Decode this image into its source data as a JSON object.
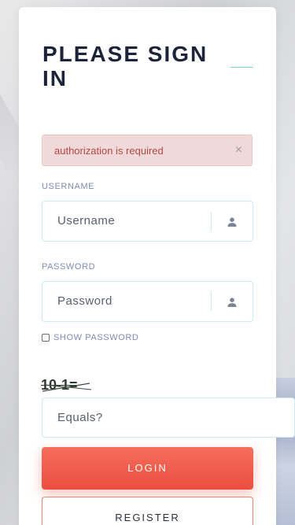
{
  "login": {
    "title": "PLEASE SIGN IN",
    "alert": {
      "message": "authorization is required",
      "close": "×"
    },
    "username": {
      "label": "USERNAME",
      "placeholder": "Username"
    },
    "password": {
      "label": "PASSWORD",
      "placeholder": "Password"
    },
    "show_password_label": "SHOW PASSWORD",
    "show_password_checked": false,
    "captcha": {
      "question": "10-1=",
      "placeholder": "Equals?"
    },
    "login_button": "LOGIN",
    "register_button": "REGISTER"
  },
  "colors": {
    "title": "#1d2339",
    "accent_line": "#7fd1e3",
    "alert_bg": "#f1d9da",
    "alert_text": "#b04a43",
    "label": "#7c8db1",
    "input_border": "#cdebf3",
    "login_button": "#ef5b49",
    "register_border": "#f08070"
  },
  "icons": {
    "username_field": "user-icon",
    "password_field": "user-icon",
    "alert_close": "close-icon"
  }
}
